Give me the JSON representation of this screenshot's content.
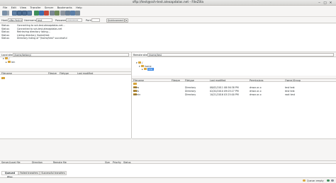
{
  "window": {
    "title": "sftp://test@ssh-test.alexapdalas.net - FileZilla"
  },
  "menu": [
    "File",
    "Edit",
    "View",
    "Transfer",
    "Server",
    "Bookmarks",
    "Help"
  ],
  "quickconnect": {
    "host_label": "Host:",
    "host_value": "sftp://ssh-test.alex",
    "user_label": "Username:",
    "user_value": "test",
    "pass_label": "Password:",
    "pass_value": "••••••••",
    "port_label": "Port:",
    "port_value": "",
    "button": "Quickconnect",
    "dropdown_icon": "chevron-down-icon"
  },
  "log": [
    {
      "k": "Status:",
      "v": "Connecting to ssh-test.alexapdalas.net..."
    },
    {
      "k": "Status:",
      "v": "Connected to ssh-test.alexapdalas.net"
    },
    {
      "k": "Status:",
      "v": "Retrieving directory listing..."
    },
    {
      "k": "Status:",
      "v": "Listing directory /home/test"
    },
    {
      "k": "Status:",
      "v": "Directory listing of \"/home/test\" successful"
    }
  ],
  "local": {
    "site_label": "Local site:",
    "path": "/home/betony/",
    "tree": [
      "/",
      "bin"
    ],
    "columns": [
      "Filename",
      "Filesize",
      "Filetype",
      "Last modified"
    ],
    "files": [
      ".."
    ]
  },
  "remote": {
    "site_label": "Remote site:",
    "path": "/home/test",
    "tree": [
      "/",
      "home",
      "test"
    ],
    "columns": [
      "Filename",
      "Filesize",
      "Filetype",
      "Last modified",
      "Permissions",
      "Owner/Group"
    ],
    "files": [
      {
        "name": "..",
        "size": "",
        "type": "",
        "modified": "",
        "perms": "",
        "owner": ""
      },
      {
        "name": "www",
        "size": "",
        "type": "Directory",
        "modified": "08/02/2011 08:56:38 PM",
        "perms": "drwxr-xr-x",
        "owner": "test test"
      },
      {
        "name": "tests",
        "size": "",
        "type": "Directory",
        "modified": "02/20/2010 09:03:27 PM",
        "perms": "drwxr-xr-x",
        "owner": "test test"
      },
      {
        "name": "admin",
        "size": "",
        "type": "Directory",
        "modified": "10/21/2016 03:25:00 PM",
        "perms": "drwxr-xr-x",
        "owner": "root test"
      }
    ]
  },
  "queue": {
    "columns": [
      "Server/Local file",
      "Direction",
      "Remote file",
      "Size",
      "Priority",
      "Status"
    ]
  },
  "tabs": [
    "Queued files",
    "Failed transfers",
    "Successful transfers"
  ],
  "status": {
    "queue": "Queue: empty"
  },
  "colors": {
    "accent": "#3584e4",
    "folder": "#d9a53a"
  }
}
